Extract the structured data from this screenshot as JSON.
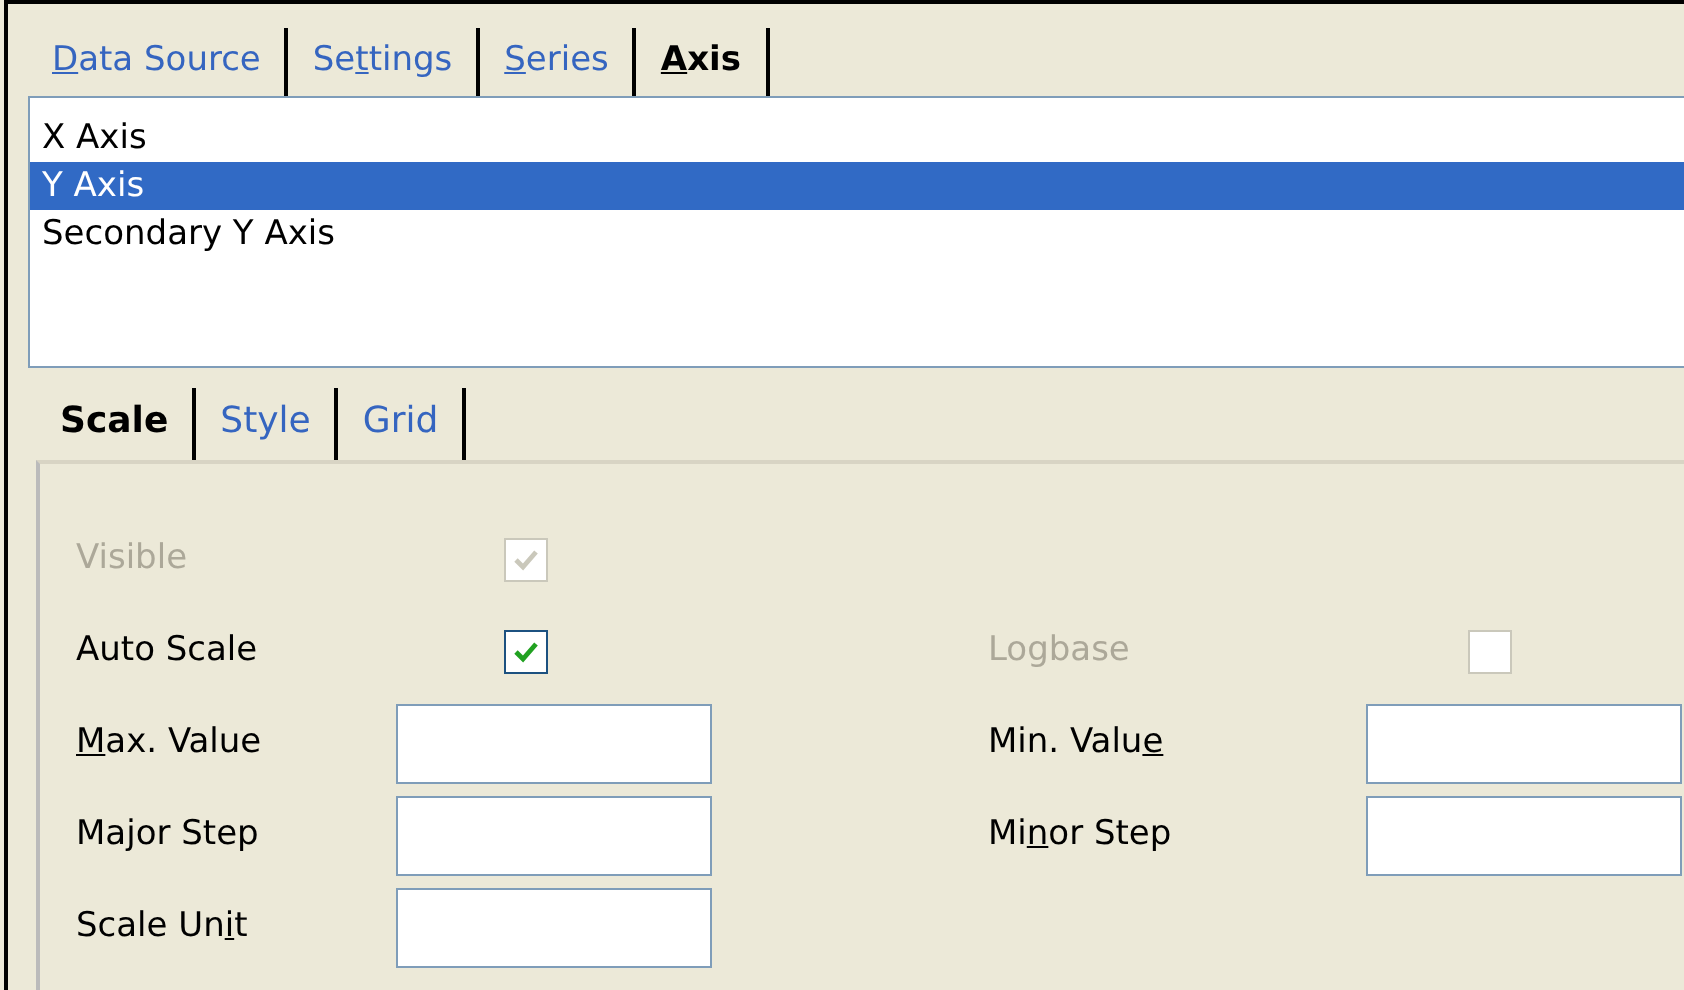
{
  "tabs": [
    {
      "label_parts": [
        {
          "text": "D",
          "underline": true
        },
        {
          "text": "ata Source",
          "underline": false
        }
      ],
      "selected": false
    },
    {
      "label_parts": [
        {
          "text": "Se",
          "underline": false
        },
        {
          "text": "t",
          "underline": true
        },
        {
          "text": "tings",
          "underline": false
        }
      ],
      "selected": false
    },
    {
      "label_parts": [
        {
          "text": "S",
          "underline": true
        },
        {
          "text": "eries",
          "underline": false
        }
      ],
      "selected": false
    },
    {
      "label_parts": [
        {
          "text": "A",
          "underline": true
        },
        {
          "text": "xis",
          "underline": false
        }
      ],
      "selected": true
    }
  ],
  "axes": [
    {
      "label": "X Axis",
      "selected": false
    },
    {
      "label": "Y Axis",
      "selected": true
    },
    {
      "label": "Secondary Y Axis",
      "selected": false
    }
  ],
  "subtabs": [
    {
      "label": "Scale",
      "selected": true
    },
    {
      "label": "Style",
      "selected": false
    },
    {
      "label": "Grid",
      "selected": false
    }
  ],
  "scale_rows": [
    [
      {
        "kind": "checkbox",
        "label_parts": [
          {
            "text": "Visible",
            "underline": false
          }
        ],
        "checked": true,
        "disabled": true
      }
    ],
    [
      {
        "kind": "checkbox",
        "label_parts": [
          {
            "text": "Auto Scale",
            "underline": false
          }
        ],
        "checked": true,
        "disabled": false
      },
      {
        "kind": "checkbox",
        "label_parts": [
          {
            "text": "Logbase",
            "underline": false
          }
        ],
        "checked": false,
        "disabled": true
      }
    ],
    [
      {
        "kind": "input",
        "label_parts": [
          {
            "text": "M",
            "underline": true
          },
          {
            "text": "ax. Value",
            "underline": false
          }
        ]
      },
      {
        "kind": "input",
        "label_parts": [
          {
            "text": "Min. Valu",
            "underline": false
          },
          {
            "text": "e",
            "underline": true
          }
        ]
      }
    ],
    [
      {
        "kind": "input",
        "label_parts": [
          {
            "text": "Ma",
            "underline": false
          },
          {
            "text": "j",
            "underline": true
          },
          {
            "text": "or Step",
            "underline": false
          }
        ]
      },
      {
        "kind": "input",
        "label_parts": [
          {
            "text": "Mi",
            "underline": false
          },
          {
            "text": "n",
            "underline": true
          },
          {
            "text": "or Step",
            "underline": false
          }
        ]
      }
    ],
    [
      {
        "kind": "input",
        "label_parts": [
          {
            "text": "Scale Un",
            "underline": false
          },
          {
            "text": "i",
            "underline": true
          },
          {
            "text": "t",
            "underline": false
          }
        ]
      }
    ]
  ]
}
